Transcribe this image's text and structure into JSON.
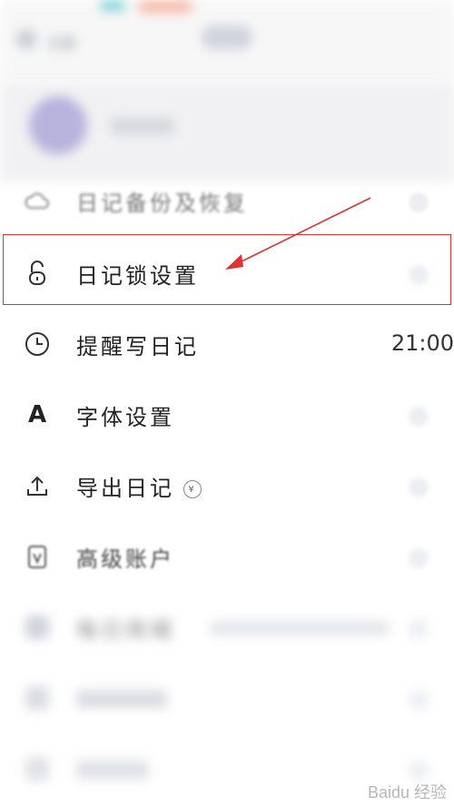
{
  "header": {
    "title": "设置",
    "action_label": ""
  },
  "menu": {
    "backup": {
      "label": "日记备份及恢复"
    },
    "lock": {
      "label": "日记锁设置"
    },
    "reminder": {
      "label": "提醒写日记",
      "value": "21:00"
    },
    "font": {
      "label": "字体设置",
      "icon_glyph": "A"
    },
    "export": {
      "label": "导出日记",
      "badge": "¥"
    },
    "premium": {
      "label": "高级账户"
    },
    "store": {
      "label": "每日商城"
    }
  },
  "annotation": {
    "color": "#d33333"
  },
  "watermark": {
    "text": "Baidu 经验"
  },
  "colors": {
    "accent": "#d33333",
    "text": "#222222"
  }
}
